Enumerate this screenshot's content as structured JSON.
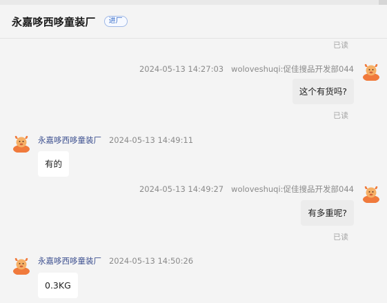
{
  "header": {
    "title": "永嘉哆西哆童装厂",
    "badge": "进厂"
  },
  "messages": [
    {
      "read": "已读"
    },
    {
      "timestamp": "2024-05-13 14:27:03",
      "sender": "woloveshuqi:促佳搜品开发部044",
      "text": "这个有货吗?",
      "read": "已读"
    },
    {
      "sender": "永嘉哆西哆童装厂",
      "timestamp": "2024-05-13 14:49:11",
      "text": "有的"
    },
    {
      "timestamp": "2024-05-13 14:49:27",
      "sender": "woloveshuqi:促佳搜品开发部044",
      "text": "有多重呢?",
      "read": "已读"
    },
    {
      "sender": "永嘉哆西哆童装厂",
      "timestamp": "2024-05-13 14:50:26",
      "text": "0.3KG"
    }
  ],
  "colors": {
    "accent": "#3c4f8f",
    "badge": "#3b6fc9",
    "avatar": "#f07a3c"
  }
}
